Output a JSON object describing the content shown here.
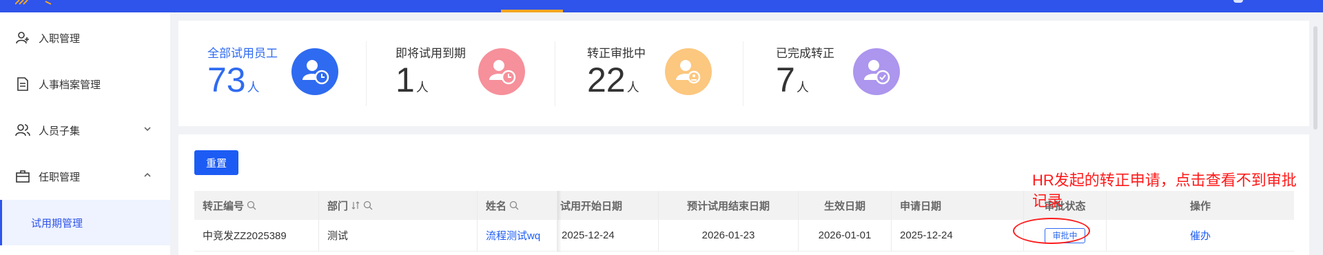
{
  "sidebar": {
    "items": [
      {
        "label": "入职管理",
        "icon": "user-add-icon"
      },
      {
        "label": "人事档案管理",
        "icon": "document-icon"
      },
      {
        "label": "人员子集",
        "icon": "users-icon",
        "chevron": "down"
      },
      {
        "label": "任职管理",
        "icon": "briefcase-icon",
        "chevron": "up"
      }
    ],
    "active_sub": "试用期管理"
  },
  "stats": [
    {
      "label": "全部试用员工",
      "value": "73",
      "unit": "人",
      "color": "#2f6bf0",
      "icon": "user-clock-icon",
      "icon_bg": "#2f6bf0"
    },
    {
      "label": "即将试用到期",
      "value": "1",
      "unit": "人",
      "color": "#333333",
      "icon": "user-clock-icon",
      "icon_bg": "#f6909a"
    },
    {
      "label": "转正审批中",
      "value": "22",
      "unit": "人",
      "color": "#333333",
      "icon": "user-approval-icon",
      "icon_bg": "#fcc77f"
    },
    {
      "label": "已完成转正",
      "value": "7",
      "unit": "人",
      "color": "#333333",
      "icon": "user-check-icon",
      "icon_bg": "#ac96ee"
    }
  ],
  "toolbar": {
    "reset_label": "重置"
  },
  "table": {
    "headers": {
      "code": "转正编号",
      "dept": "部门",
      "name": "姓名",
      "start": "试用开始日期",
      "expected_end": "预计试用结束日期",
      "effective": "生效日期",
      "apply": "申请日期",
      "status": "审批状态",
      "action": "操作"
    },
    "row": {
      "code": "中竞发ZZ2025389",
      "dept": "测试",
      "name": "流程测试wq",
      "start": "2025-12-24",
      "expected_end": "2026-01-23",
      "effective": "2026-01-01",
      "apply": "2025-12-24",
      "status": "审批中",
      "action": "催办"
    }
  },
  "annotation": {
    "text": "HR发起的转正申请，点击查看不到审批记录",
    "color": "#ff1a1a"
  },
  "colors": {
    "topbar": "#2f54eb",
    "accent": "#1d5cf4"
  }
}
